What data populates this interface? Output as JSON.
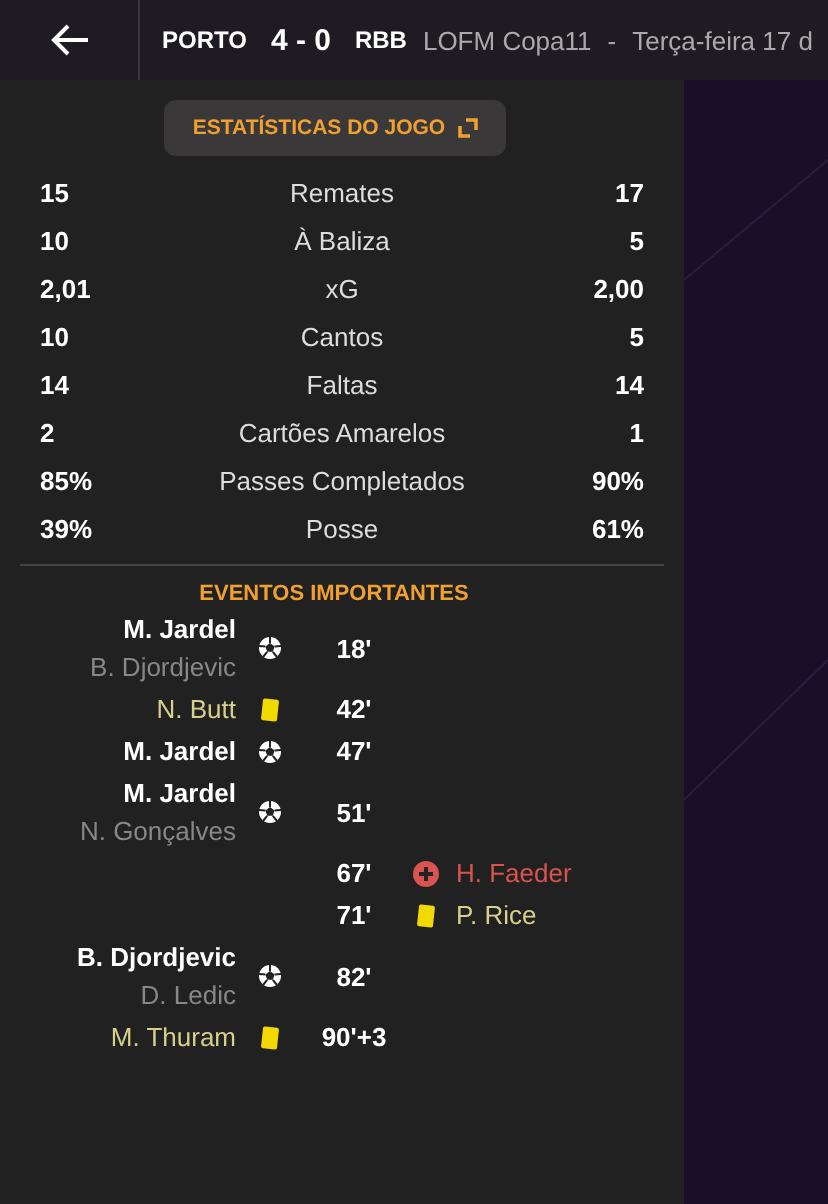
{
  "header": {
    "home_team": "PORTO",
    "score": "4 - 0",
    "away_team": "RBB",
    "competition": "LOFM Copa11",
    "separator": "-",
    "date": "Terça-feira 17 d"
  },
  "stats_button": {
    "label": "ESTATÍSTICAS DO JOGO"
  },
  "stats": [
    {
      "home": "15",
      "label": "Remates",
      "away": "17"
    },
    {
      "home": "10",
      "label": "À Baliza",
      "away": "5"
    },
    {
      "home": "2,01",
      "label": "xG",
      "away": "2,00"
    },
    {
      "home": "10",
      "label": "Cantos",
      "away": "5"
    },
    {
      "home": "14",
      "label": "Faltas",
      "away": "14"
    },
    {
      "home": "2",
      "label": "Cartões Amarelos",
      "away": "1"
    },
    {
      "home": "85%",
      "label": "Passes Completados",
      "away": "90%"
    },
    {
      "home": "39%",
      "label": "Posse",
      "away": "61%"
    }
  ],
  "events_title": "EVENTOS IMPORTANTES",
  "events": [
    {
      "away": false,
      "kind": "goal",
      "player": "M. Jardel",
      "assist": "B. Djordjevic",
      "minute": "18'"
    },
    {
      "away": false,
      "kind": "booking",
      "player": "N. Butt",
      "minute": "42'"
    },
    {
      "away": false,
      "kind": "goal",
      "player": "M. Jardel",
      "minute": "47'"
    },
    {
      "away": false,
      "kind": "goal",
      "player": "M. Jardel",
      "assist": "N. Gonçalves",
      "minute": "51'"
    },
    {
      "away": true,
      "kind": "injury",
      "player": "H. Faeder",
      "minute": "67'"
    },
    {
      "away": true,
      "kind": "booking",
      "player": "P. Rice",
      "minute": "71'"
    },
    {
      "away": false,
      "kind": "goal",
      "player": "B. Djordjevic",
      "assist": "D. Ledic",
      "minute": "82'"
    },
    {
      "away": false,
      "kind": "booking",
      "player": "M. Thuram",
      "minute": "90'+3"
    }
  ]
}
